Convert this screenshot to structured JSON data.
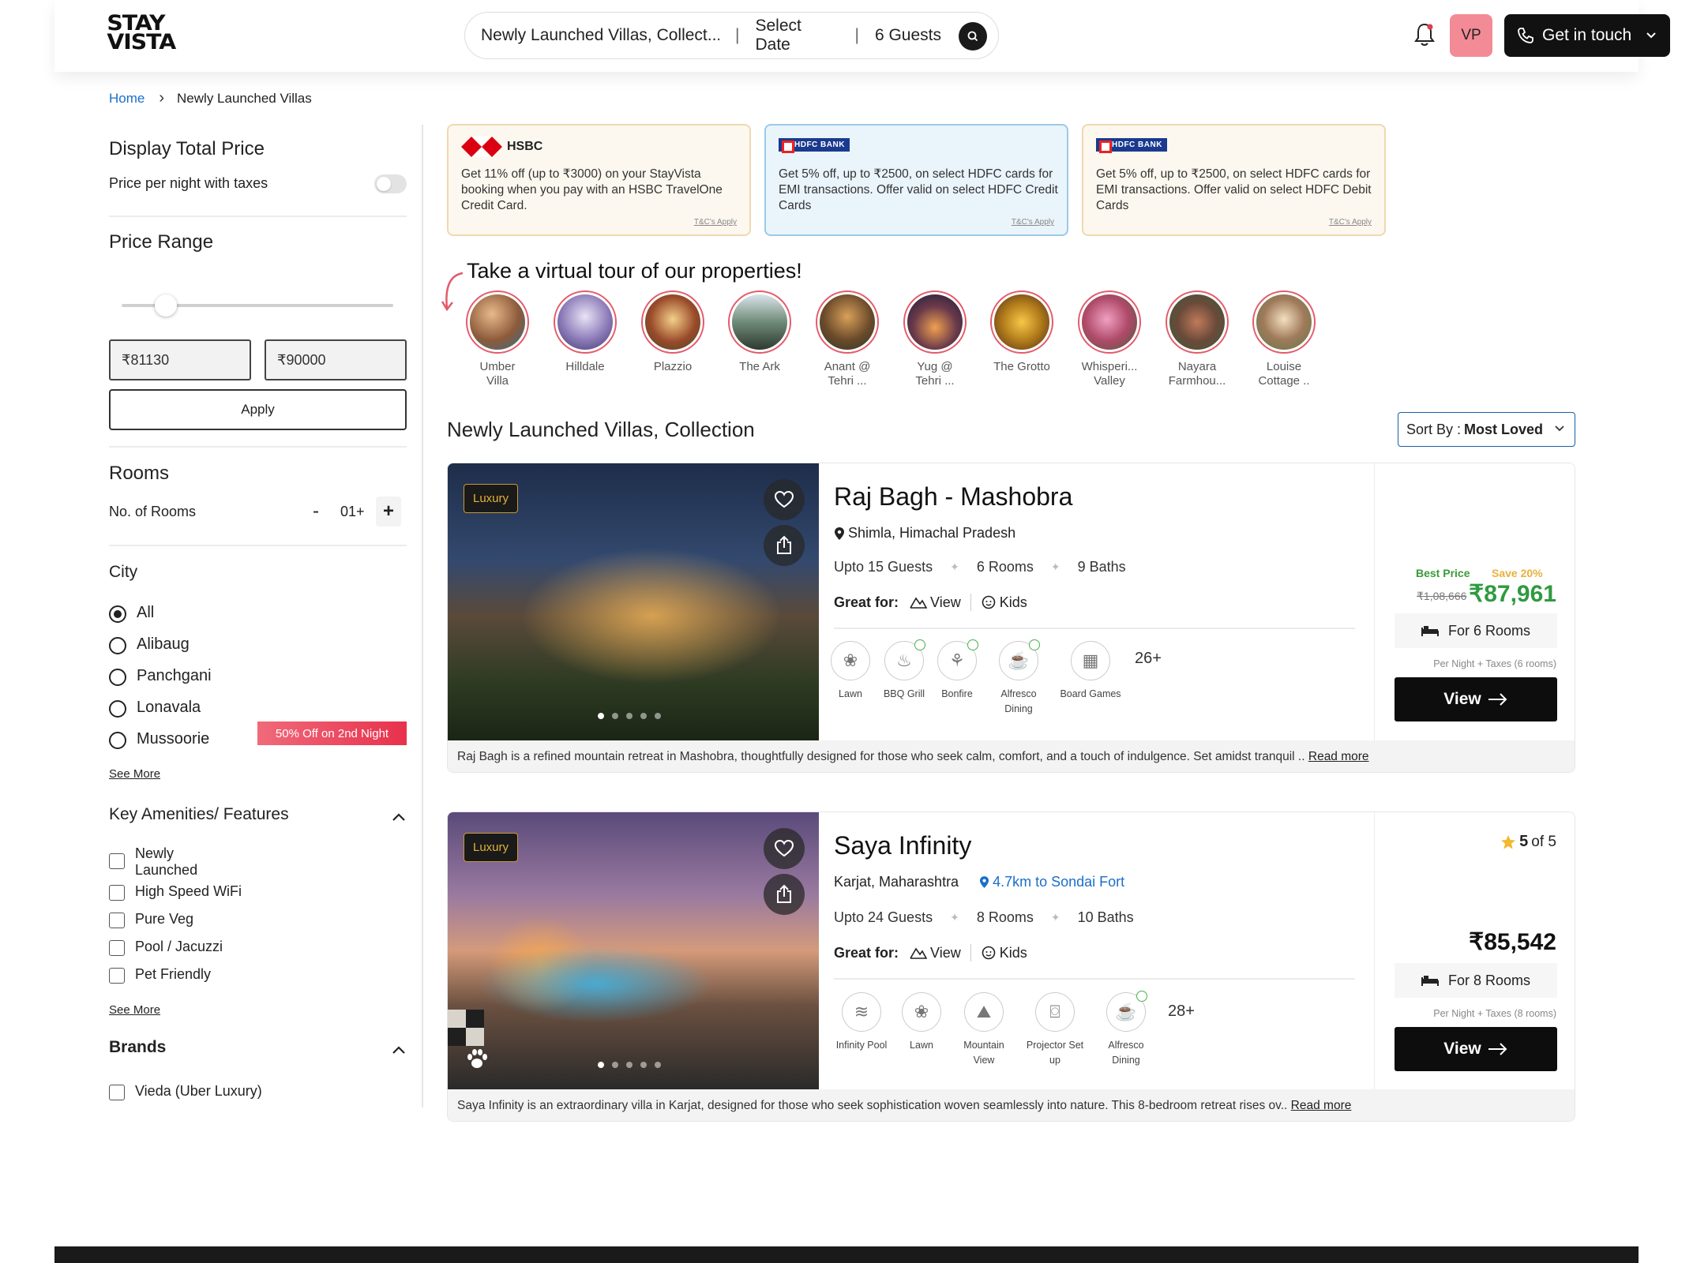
{
  "header": {
    "logo_line1": "STAY",
    "logo_line2": "VISTA",
    "search_location": "Newly Launched Villas, Collect...",
    "search_date": "Select Date",
    "search_guests": "6 Guests",
    "avatar_initials": "VP",
    "contact_label": "Get in touch"
  },
  "breadcrumb": {
    "home": "Home",
    "current": "Newly Launched Villas"
  },
  "sidebar": {
    "display_total_title": "Display Total Price",
    "display_total_sub": "Price per night with taxes",
    "price_range_title": "Price Range",
    "min_price": "81130",
    "max_price": "90000",
    "currency_symbol": "₹",
    "apply_label": "Apply",
    "rooms_title": "Rooms",
    "rooms_label": "No. of Rooms",
    "rooms_value": "01+",
    "city_title": "City",
    "cities": [
      "All",
      "Alibaug",
      "Panchgani",
      "Lonavala",
      "Mussoorie"
    ],
    "see_more": "See More",
    "amenities_title": "Key Amenities/ Features",
    "amenities": [
      "Newly Launched",
      "High Speed WiFi",
      "Pure Veg",
      "Pool / Jacuzzi",
      "Pet Friendly"
    ],
    "promo_tag": "50% Off on 2nd Night",
    "brands_title": "Brands",
    "brands": [
      "Vieda (Uber Luxury)"
    ]
  },
  "offers": [
    {
      "bank": "HSBC",
      "text": "Get 11% off (up to ₹3000) on your StayVista booking when you pay with an HSBC TravelOne Credit Card.",
      "tc": "T&C's Apply"
    },
    {
      "bank": "HDFC BANK",
      "text": "Get 5% off, up to ₹2500, on select HDFC cards for EMI transactions. Offer valid on select HDFC Credit Cards",
      "tc": "T&C's Apply"
    },
    {
      "bank": "HDFC BANK",
      "text": "Get 5% off, up to ₹2500, on select HDFC cards for EMI transactions. Offer valid on select HDFC Debit Cards",
      "tc": "T&C's Apply"
    }
  ],
  "tour": {
    "title": "Take a virtual tour of our properties!",
    "items": [
      {
        "line1": "Umber",
        "line2": "Villa"
      },
      {
        "line1": "Hilldale",
        "line2": ""
      },
      {
        "line1": "Plazzio",
        "line2": ""
      },
      {
        "line1": "The Ark",
        "line2": ""
      },
      {
        "line1": "Anant @",
        "line2": "Tehri ..."
      },
      {
        "line1": "Yug @",
        "line2": "Tehri ..."
      },
      {
        "line1": "The Grotto",
        "line2": ""
      },
      {
        "line1": "Whisperi...",
        "line2": "Valley"
      },
      {
        "line1": "Nayara",
        "line2": "Farmhou..."
      },
      {
        "line1": "Louise",
        "line2": "Cottage .."
      }
    ]
  },
  "collection": {
    "title": "Newly Launched Villas, Collection",
    "sort_prefix": "Sort By :",
    "sort_value": "Most Loved"
  },
  "listings": [
    {
      "badge": "Luxury",
      "name": "Raj Bagh - Mashobra",
      "location": "Shimla, Himachal Pradesh",
      "distance": "",
      "guests": "Upto 15 Guests",
      "rooms": "6 Rooms",
      "baths": "9 Baths",
      "great_for_label": "Great for:",
      "great_for": [
        "View",
        "Kids"
      ],
      "amenities": [
        "Lawn",
        "BBQ Grill",
        "Bonfire",
        "Alfresco Dining",
        "Board Games"
      ],
      "amenities_more": "26+",
      "best_price_label": "Best Price",
      "save_label": "Save 20%",
      "original_price": "₹1,08,666",
      "price": "₹87,961",
      "for_rooms": "For 6 Rooms",
      "per_night": "Per Night + Taxes (6 rooms)",
      "view_label": "View",
      "rating_value": "",
      "rating_suffix": "",
      "description": "Raj Bagh is a refined mountain retreat in Mashobra, thoughtfully designed for those who seek calm, comfort, and a touch of indulgence. Set amidst tranquil ..",
      "read_more": "Read more"
    },
    {
      "badge": "Luxury",
      "name": "Saya Infinity",
      "location": "Karjat, Maharashtra",
      "distance": "4.7km to Sondai Fort",
      "guests": "Upto 24 Guests",
      "rooms": "8 Rooms",
      "baths": "10 Baths",
      "great_for_label": "Great for:",
      "great_for": [
        "View",
        "Kids"
      ],
      "amenities": [
        "Infinity Pool",
        "Lawn",
        "Mountain View",
        "Projector Set up",
        "Alfresco Dining"
      ],
      "amenities_more": "28+",
      "best_price_label": "",
      "save_label": "",
      "original_price": "",
      "price": "₹85,542",
      "for_rooms": "For 8 Rooms",
      "per_night": "Per Night + Taxes (8 rooms)",
      "view_label": "View",
      "rating_value": "5",
      "rating_suffix": "of 5",
      "description": "Saya Infinity is an extraordinary villa in Karjat, designed for those who seek sophistication woven seamlessly into nature. This 8-bedroom retreat rises ov..",
      "read_more": "Read more"
    }
  ],
  "colors": {
    "accent_pink": "#f28b96",
    "price_green": "#2f9a3f",
    "link_blue": "#1a6fc9",
    "badge_gold": "#e2b33a"
  }
}
